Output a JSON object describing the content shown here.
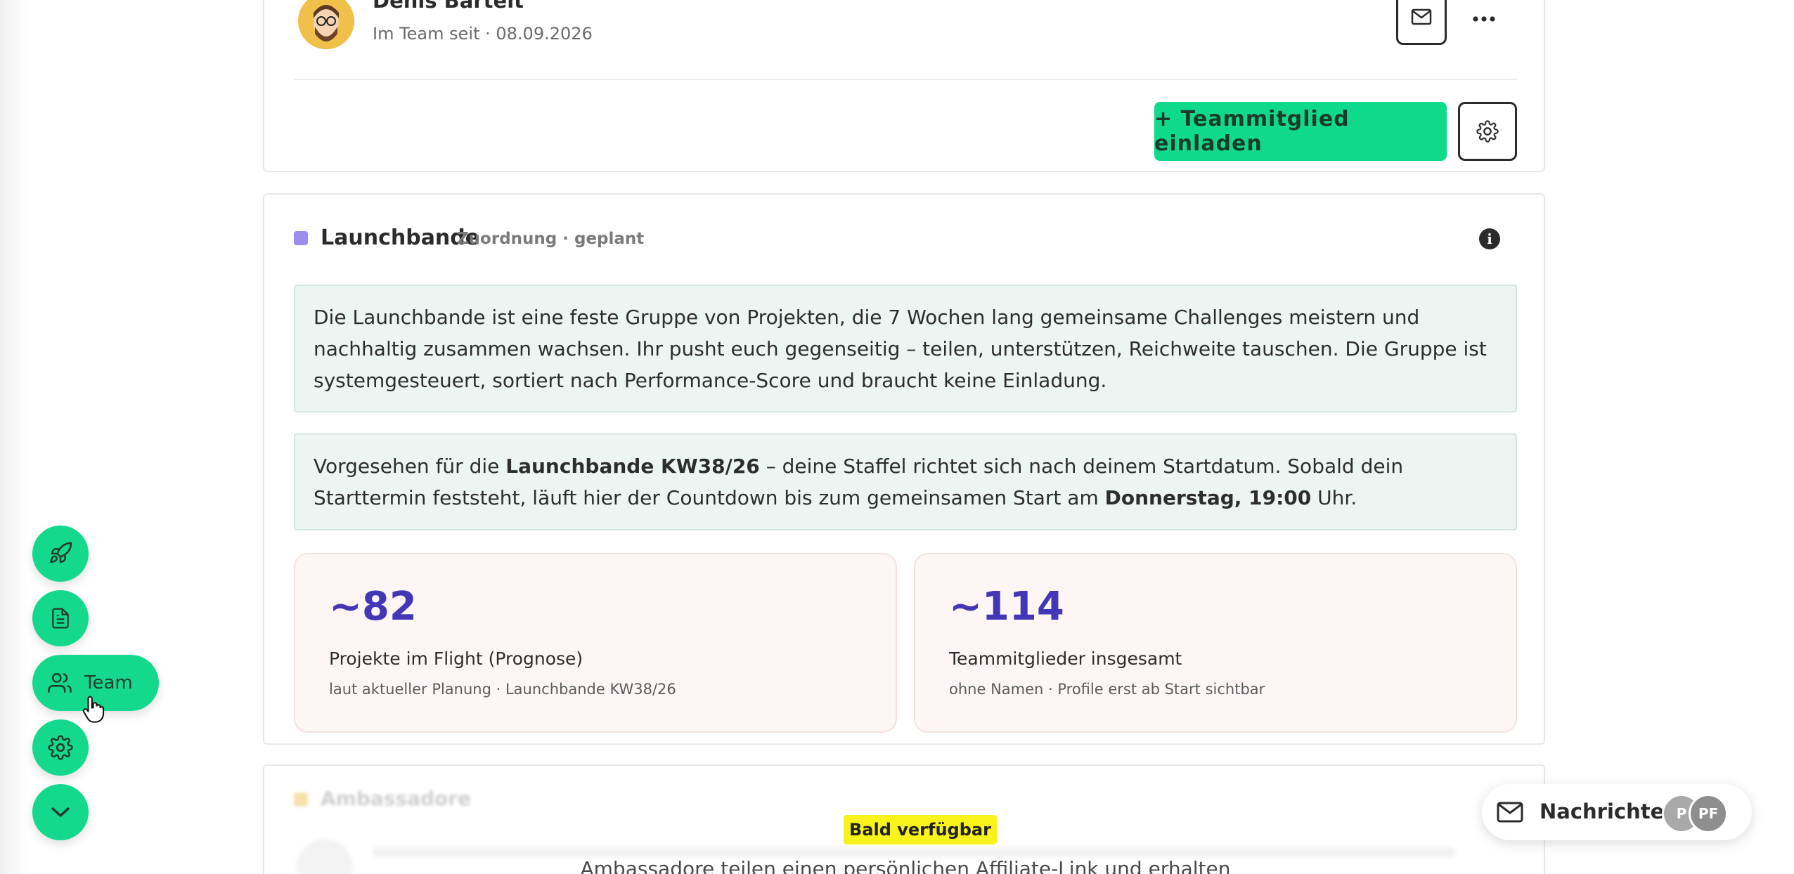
{
  "member": {
    "name": "Denis Bartelt",
    "since": "Im Team seit · 08.09.2026",
    "invite_label": "+ Teammitglied einladen"
  },
  "launchband": {
    "title": "Launchbande",
    "subtitle": "Zuordnung · geplant",
    "description": "Die Launchbande ist eine feste Gruppe von Projekten, die 7 Wochen lang gemeinsame Challenges meistern und nachhaltig zusammen wachsen. Ihr pusht euch gegenseitig – teilen, unterstützen, Reichweite tauschen. Die Gruppe ist systemgesteuert, sortiert nach Performance-Score und braucht keine Einladung.",
    "schedule": {
      "prefix": "Vorgesehen für die ",
      "band": "Launchbande KW38/26",
      "middle": " – deine Staffel richtet sich nach deinem Startdatum. Sobald dein Starttermin feststeht, läuft hier der Countdown bis zum gemeinsamen Start am ",
      "start": "Donnerstag, 19:00",
      "suffix": " Uhr."
    },
    "stats": [
      {
        "value": "~82",
        "label": "Projekte im Flight (Prognose)",
        "note": "laut aktueller Planung · Launchbande KW38/26"
      },
      {
        "value": "~114",
        "label": "Teammitglieder insgesamt",
        "note": "ohne Namen · Profile erst ab Start sichtbar"
      }
    ]
  },
  "ambassadors": {
    "title": "Ambassadore",
    "badge": "Bald verfügbar",
    "text": "Ambassadore teilen einen persönlichen Affiliate-Link und erhalten"
  },
  "nav": {
    "team_label": "Team"
  },
  "messages": {
    "label": "Nachrichten",
    "avatars": [
      "P",
      "PF"
    ]
  },
  "colors": {
    "accent_green": "#14d98d",
    "stat_value": "#4337b8",
    "launchband_dot": "#9d8df1",
    "badge_yellow": "#f7f31b"
  },
  "icons": [
    "envelope-icon",
    "more-icon",
    "gear-icon",
    "info-icon",
    "rocket-icon",
    "document-icon",
    "team-icon",
    "chevron-down-icon",
    "hand-pointer-icon"
  ]
}
